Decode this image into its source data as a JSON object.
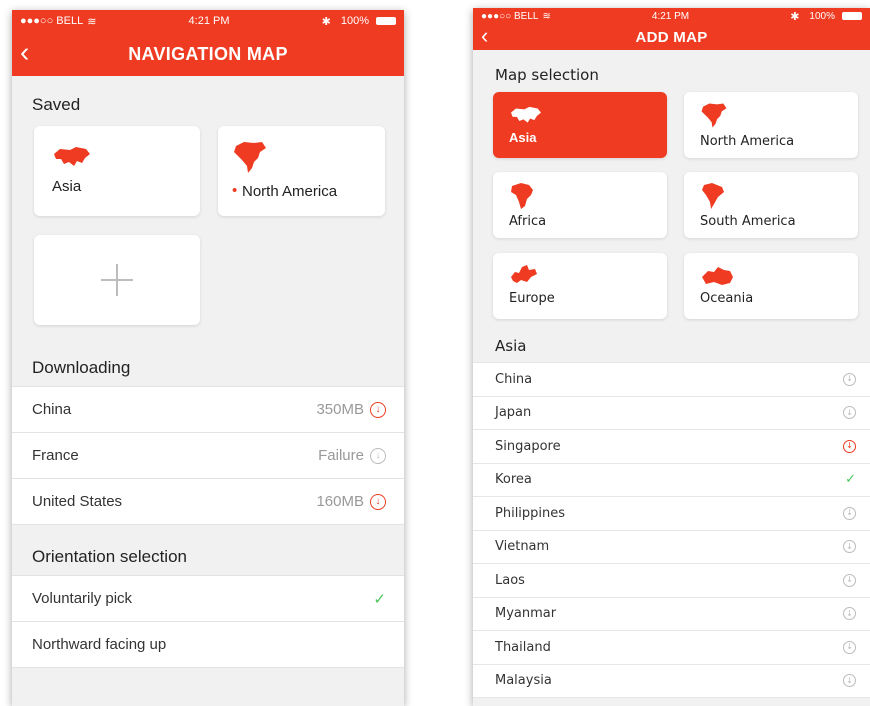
{
  "left": {
    "status": {
      "carrier": "●●●○○ BELL",
      "time": "4:21 PM",
      "battery": "100%"
    },
    "title": "NAVIGATION MAP",
    "saved": {
      "title": "Saved",
      "cards": [
        {
          "label": "Asia",
          "icon": "asia-map-icon"
        },
        {
          "label": "North America",
          "icon": "north-america-map-icon",
          "marker": "•"
        }
      ]
    },
    "downloading": {
      "title": "Downloading",
      "rows": [
        {
          "name": "China",
          "meta": "350MB",
          "icon": "download-red"
        },
        {
          "name": "France",
          "meta": "Failure",
          "icon": "download-gray"
        },
        {
          "name": "United States",
          "meta": "160MB",
          "icon": "download-red"
        }
      ]
    },
    "orientation": {
      "title": "Orientation selection",
      "rows": [
        {
          "name": "Voluntarily pick",
          "checked": true
        },
        {
          "name": "Northward facing up",
          "checked": false
        }
      ]
    }
  },
  "right": {
    "status": {
      "carrier": "●●●○○ BELL",
      "time": "4:21 PM",
      "battery": "100%"
    },
    "title": "ADD MAP",
    "map_selection": {
      "title": "Map selection",
      "cards": [
        {
          "label": "Asia",
          "active": true
        },
        {
          "label": "North America"
        },
        {
          "label": "Africa"
        },
        {
          "label": "South America"
        },
        {
          "label": "Europe"
        },
        {
          "label": "Oceania"
        }
      ]
    },
    "asia": {
      "title": "Asia",
      "rows": [
        {
          "name": "China",
          "status": "download"
        },
        {
          "name": "Japan",
          "status": "download"
        },
        {
          "name": "Singapore",
          "status": "downloading"
        },
        {
          "name": "Korea",
          "status": "done"
        },
        {
          "name": "Philippines",
          "status": "download"
        },
        {
          "name": "Vietnam",
          "status": "download"
        },
        {
          "name": "Laos",
          "status": "download"
        },
        {
          "name": "Myanmar",
          "status": "download"
        },
        {
          "name": "Thailand",
          "status": "download"
        },
        {
          "name": "Malaysia",
          "status": "download"
        }
      ]
    }
  },
  "colors": {
    "accent": "#ee3b22",
    "check": "#4cc55a",
    "background": "#f1f1f1"
  },
  "glyphs": {
    "download": "↓",
    "check": "✓",
    "back": "‹"
  }
}
